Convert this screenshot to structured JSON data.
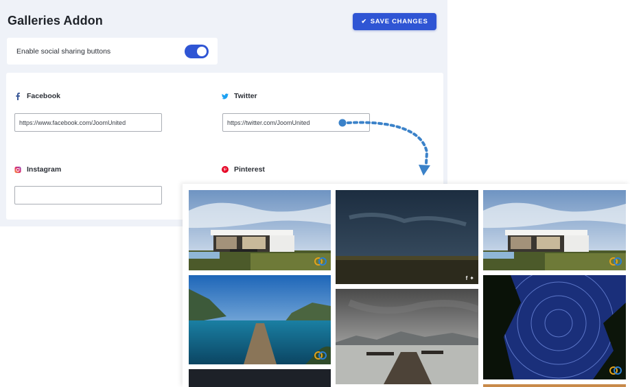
{
  "header": {
    "title": "Galleries Addon",
    "save_label": "SAVE CHANGES"
  },
  "settings": {
    "social_sharing_label": "Enable social sharing buttons",
    "social_sharing_enabled": true
  },
  "networks": {
    "facebook": {
      "label": "Facebook",
      "value": "https://www.facebook.com/JoomUnited",
      "icon": "facebook-icon",
      "color": "#3b5998"
    },
    "twitter": {
      "label": "Twitter",
      "value": "https://twitter.com/JoomUnited",
      "icon": "twitter-icon",
      "color": "#1da1f2"
    },
    "instagram": {
      "label": "Instagram",
      "value": "",
      "icon": "instagram-icon",
      "color": "#c13584"
    },
    "pinterest": {
      "label": "Pinterest",
      "icon": "pinterest-icon",
      "color": "#e60023"
    }
  },
  "gallery": {
    "share_icons": [
      "f",
      "🐦"
    ],
    "photos": [
      "modern-house",
      "night-field",
      "modern-house",
      "lake-pier",
      "mountain-lake-dock",
      "star-trails"
    ]
  },
  "colors": {
    "accent": "#2f55d4",
    "arrow": "#3b82c9",
    "panel_bg": "#eff2f8"
  }
}
